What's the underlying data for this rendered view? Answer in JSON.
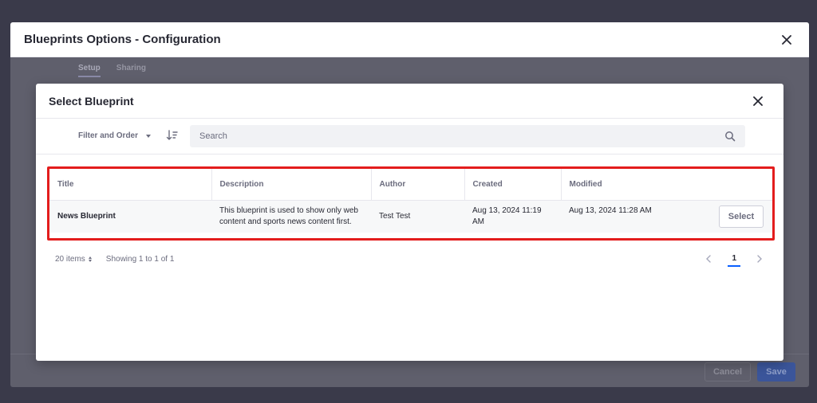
{
  "outer": {
    "title": "Blueprints Options - Configuration",
    "tabs": [
      "Setup",
      "Sharing"
    ],
    "cancel_label": "Cancel",
    "save_label": "Save"
  },
  "modal": {
    "title": "Select Blueprint",
    "filter_label": "Filter and Order",
    "search_placeholder": "Search"
  },
  "table": {
    "columns": [
      "Title",
      "Description",
      "Author",
      "Created",
      "Modified"
    ],
    "rows": [
      {
        "title": "News Blueprint",
        "description": "This blueprint is used to show only web content and sports news content first.",
        "author": "Test Test",
        "created": "Aug 13, 2024 11:19 AM",
        "modified": "Aug 13, 2024 11:28 AM",
        "action": "Select"
      }
    ]
  },
  "pagination": {
    "items_label": "20 items",
    "showing": "Showing 1 to 1 of 1",
    "current_page": "1"
  },
  "colors": {
    "highlight": "#e31d1d",
    "primary": "#0b5fff"
  }
}
